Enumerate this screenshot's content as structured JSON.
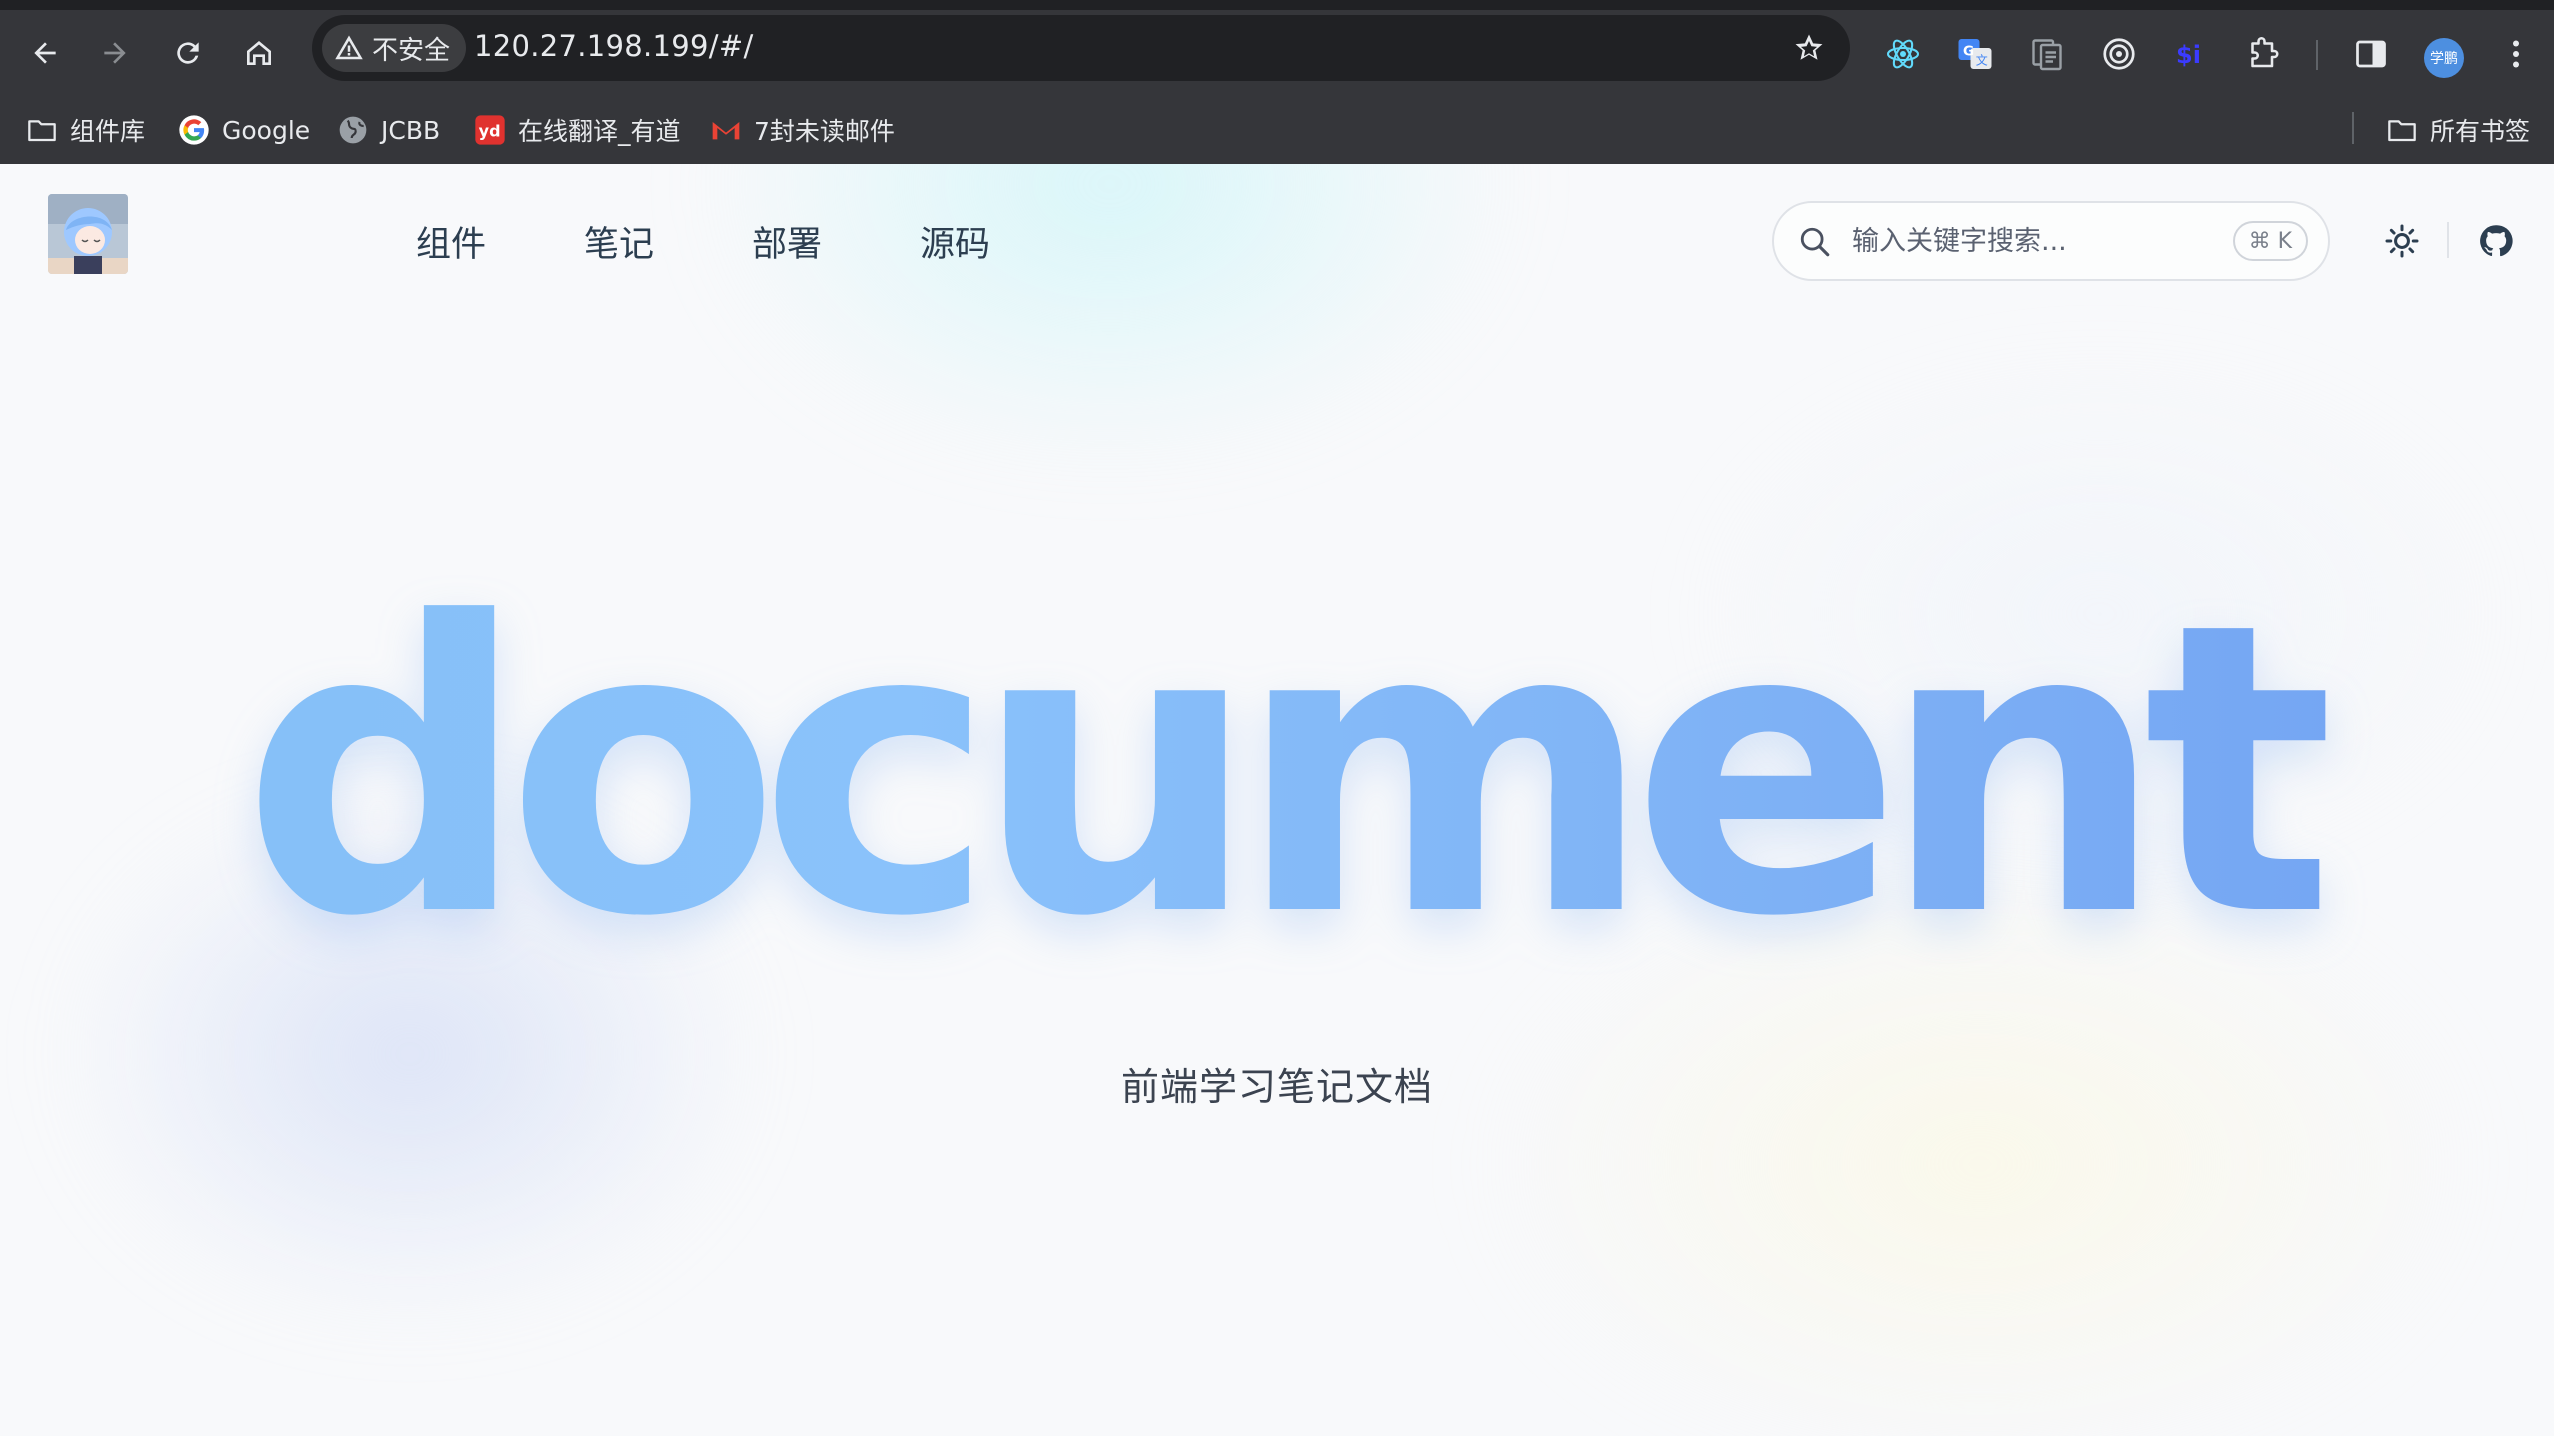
{
  "browser": {
    "security_label": "不安全",
    "url": "120.27.198.199/#/",
    "profile_label": "学鹏"
  },
  "bookmarks": {
    "items": [
      {
        "label": "组件库",
        "icon": "folder-icon"
      },
      {
        "label": "Google",
        "icon": "google-icon"
      },
      {
        "label": "JCBB",
        "icon": "globe-icon"
      },
      {
        "label": "在线翻译_有道",
        "icon": "youdao-icon"
      },
      {
        "label": "7封未读邮件",
        "icon": "gmail-icon"
      }
    ],
    "all_bookmarks": "所有书签"
  },
  "site": {
    "nav": [
      {
        "label": "组件"
      },
      {
        "label": "笔记"
      },
      {
        "label": "部署"
      },
      {
        "label": "源码"
      }
    ],
    "search": {
      "placeholder": "输入关键字搜索...",
      "shortcut": "⌘ K"
    },
    "hero_title": "document",
    "hero_subtitle": "前端学习笔记文档"
  },
  "colors": {
    "chrome_bg": "#35363a",
    "omnibox_bg": "#202124",
    "hero_gradient_start": "#84bff6",
    "hero_gradient_end": "#71a2f2",
    "text_primary": "#2c3e50"
  }
}
